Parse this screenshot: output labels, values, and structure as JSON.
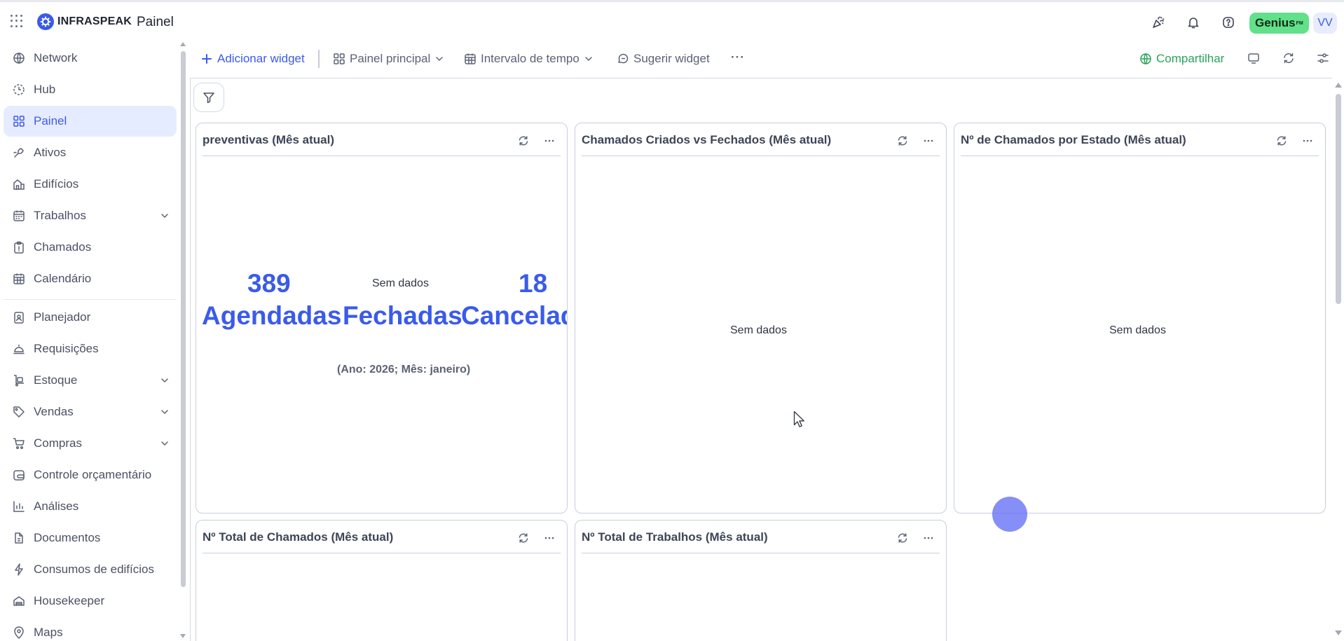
{
  "header": {
    "logo_text": "INFRASPEAK",
    "page_title": "Painel",
    "icons": [
      "apps-grid-icon",
      "party-popper-icon",
      "bell-icon",
      "help-icon"
    ],
    "genius_label": "Genius",
    "genius_sup": "FM",
    "user_initials": "VV",
    "colors": {
      "brand": "#3a5bea",
      "genius_bg": "#62e08a"
    }
  },
  "sidebar": {
    "items": [
      {
        "label": "Network",
        "icon": "network-globe-icon",
        "active": false,
        "expandable": false
      },
      {
        "label": "Hub",
        "icon": "hub-clock-icon",
        "active": false,
        "expandable": false
      },
      {
        "label": "Painel",
        "icon": "dashboard-grid-icon",
        "active": true,
        "expandable": false
      },
      {
        "label": "Ativos",
        "icon": "assets-icon",
        "active": false,
        "expandable": false
      },
      {
        "label": "Edifícios",
        "icon": "building-icon",
        "active": false,
        "expandable": false
      },
      {
        "label": "Trabalhos",
        "icon": "calendar-work-icon",
        "active": false,
        "expandable": true
      },
      {
        "label": "Chamados",
        "icon": "clipboard-icon",
        "active": false,
        "expandable": false
      },
      {
        "label": "Calendário",
        "icon": "calendar-icon",
        "active": false,
        "expandable": false
      },
      {
        "label": "Planejador",
        "icon": "planner-icon",
        "active": false,
        "expandable": false
      },
      {
        "label": "Requisições",
        "icon": "bell-service-icon",
        "active": false,
        "expandable": false
      },
      {
        "label": "Estoque",
        "icon": "stock-icon",
        "active": false,
        "expandable": true
      },
      {
        "label": "Vendas",
        "icon": "tag-icon",
        "active": false,
        "expandable": true
      },
      {
        "label": "Compras",
        "icon": "cart-icon",
        "active": false,
        "expandable": true
      },
      {
        "label": "Controle orçamentário",
        "icon": "budget-icon",
        "active": false,
        "expandable": false
      },
      {
        "label": "Análises",
        "icon": "chart-bars-icon",
        "active": false,
        "expandable": false
      },
      {
        "label": "Documentos",
        "icon": "document-icon",
        "active": false,
        "expandable": false
      },
      {
        "label": "Consumos de edifícios",
        "icon": "lightning-icon",
        "active": false,
        "expandable": false
      },
      {
        "label": "Housekeeper",
        "icon": "housekeeper-icon",
        "active": false,
        "expandable": false
      },
      {
        "label": "Maps",
        "icon": "map-pin-icon",
        "active": false,
        "expandable": false
      }
    ]
  },
  "toolbar": {
    "add_widget": "Adicionar widget",
    "dashboard_select": "Painel principal",
    "time_interval": "Intervalo de tempo",
    "suggest_widget": "Sugerir widget",
    "more": "···",
    "share": "Compartilhar",
    "colors": {
      "add": "#3a5bea",
      "share": "#2aa35c"
    }
  },
  "widgets": {
    "preventivas": {
      "title": "preventivas (Mês atual)",
      "scheduled_value": "389",
      "no_data": "Sem dados",
      "cancelled_value": "18",
      "label_scheduled": "Agendadas",
      "label_closed": "Fechadas",
      "label_cancelled": "Cancelad",
      "caption": "(Ano: 2026; Mês: janeiro)"
    },
    "created_vs_closed": {
      "title": "Chamados Criados vs Fechados (Mês atual)",
      "no_data": "Sem dados"
    },
    "by_state": {
      "title": "Nº de Chamados por Estado (Mês atual)",
      "no_data": "Sem dados"
    },
    "total_calls": {
      "title": "Nº Total de Chamados (Mês atual)"
    },
    "total_jobs": {
      "title": "Nº Total de Trabalhos (Mês atual)"
    }
  }
}
